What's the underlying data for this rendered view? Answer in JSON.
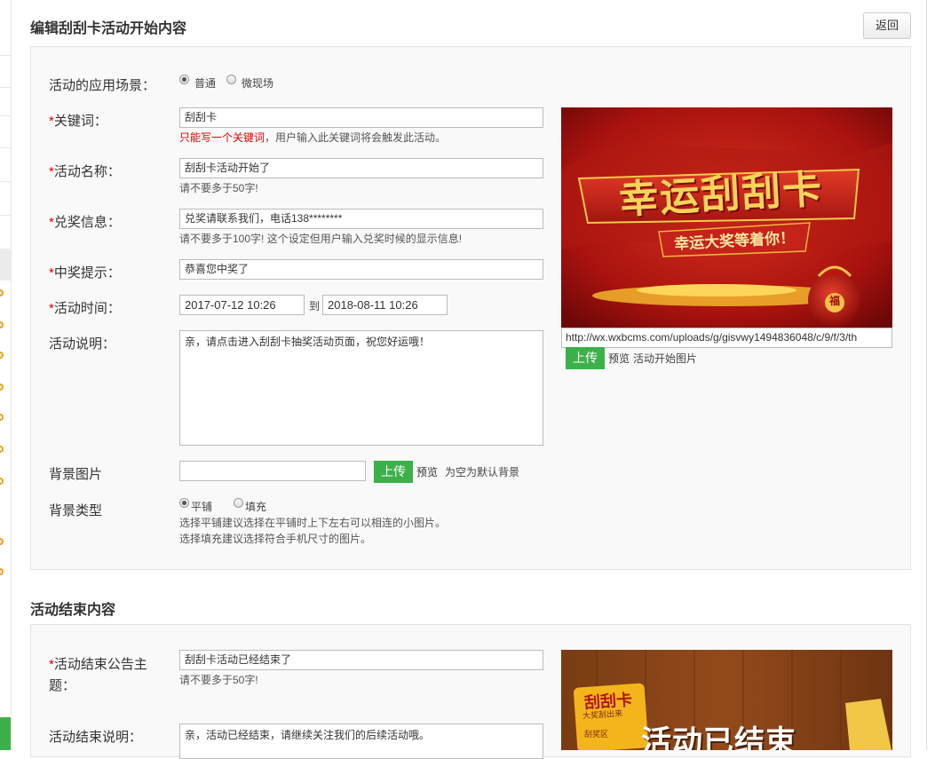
{
  "header": {
    "title": "编辑刮刮卡活动开始内容",
    "back_label": "返回"
  },
  "start": {
    "scene": {
      "label": "活动的应用场景：",
      "options": [
        "普通",
        "微现场"
      ],
      "selected": "普通"
    },
    "keyword": {
      "label": "关键词：",
      "value": "刮刮卡",
      "help_red": "只能写一个关键词",
      "help": "，用户输入此关键词将会触发此活动。"
    },
    "name": {
      "label": "活动名称：",
      "value": "刮刮卡活动开始了",
      "help": "请不要多于50字!"
    },
    "prize_info": {
      "label": "兑奖信息：",
      "value": "兑奖请联系我们，电话138********",
      "help": "请不要多于100字! 这个设定但用户输入兑奖时候的显示信息!"
    },
    "win_tip": {
      "label": "中奖提示：",
      "value": "恭喜您中奖了"
    },
    "time": {
      "label": "活动时间：",
      "start": "2017-07-12 10:26",
      "sep": "到",
      "end": "2018-08-11 10:26"
    },
    "desc": {
      "label": "活动说明：",
      "value": "亲，请点击进入刮刮卡抽奖活动页面，祝您好运哦！"
    },
    "bg_image": {
      "label": "背景图片",
      "value": "",
      "upload": "上传",
      "preview": "预览",
      "note": "为空为默认背景"
    },
    "bg_type": {
      "label": "背景类型",
      "options": [
        "平铺",
        "填充"
      ],
      "selected": "平铺",
      "help1": "选择平铺建议选择在平铺时上下左右可以相连的小图片。",
      "help2": "选择填充建议选择符合手机尺寸的图片。"
    },
    "image": {
      "title_text": "幸运刮刮卡",
      "subtitle_text": "幸运大奖等着你！",
      "bag_text": "福",
      "url": "http://wx.wxbcms.com/uploads/g/gisvwy1494836048/c/9/f/3/th",
      "upload": "上传",
      "preview": "预览",
      "caption": "活动开始图片"
    }
  },
  "end": {
    "section_title": "活动结束内容",
    "topic": {
      "label1": "活动结束公告主",
      "label2": "题：",
      "value": "刮刮卡活动已经结束了",
      "help": "请不要多于50字!"
    },
    "desc": {
      "label": "活动结束说明：",
      "value": "亲，活动已经结束，请继续关注我们的后续活动哦。"
    },
    "image": {
      "card_title": "刮刮卡",
      "card_sub": "大奖刮出来",
      "card_area": "刮奖区",
      "banner": "活动已结束"
    }
  },
  "colors": {
    "required": "#dd0000",
    "upload_green": "#3cb14a",
    "panel_bg": "#f9f9f9"
  }
}
